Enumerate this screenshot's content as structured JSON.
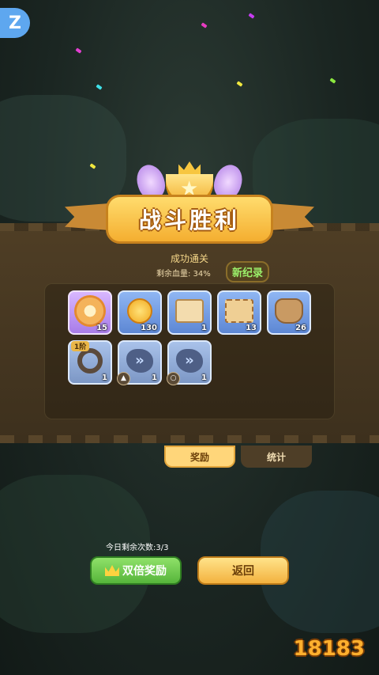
{
  "corner_badge": "Z",
  "result": {
    "title": "战斗胜利",
    "subtitle": "成功通关",
    "hp_label": "剩余血量: 34%",
    "record_badge": "新纪录"
  },
  "rewards": [
    {
      "name": "flower-badge",
      "icon": "flower-icon",
      "qty": "15"
    },
    {
      "name": "gold-coin",
      "icon": "coin-icon",
      "qty": "130"
    },
    {
      "name": "scroll",
      "icon": "scroll-icon",
      "qty": "1"
    },
    {
      "name": "treasure-map",
      "icon": "map-icon",
      "qty": "13"
    },
    {
      "name": "seed-sack",
      "icon": "sack-icon",
      "qty": "26"
    },
    {
      "name": "ring",
      "icon": "ring-icon",
      "qty": "1",
      "tier": "1阶"
    },
    {
      "name": "rune-stone-armor",
      "icon": "rune-icon",
      "qty": "1"
    },
    {
      "name": "rune-stone-ring",
      "icon": "rune-icon",
      "qty": "1"
    }
  ],
  "tabs": {
    "rewards": "奖励",
    "stats": "统计"
  },
  "remaining_today": "今日剩余次数:3/3",
  "buttons": {
    "double": "双倍奖励",
    "back": "返回"
  },
  "watermark": "18183",
  "colors": {
    "panel": "#4a3a22",
    "gold": "#f4ae30",
    "green": "#56b53b"
  }
}
